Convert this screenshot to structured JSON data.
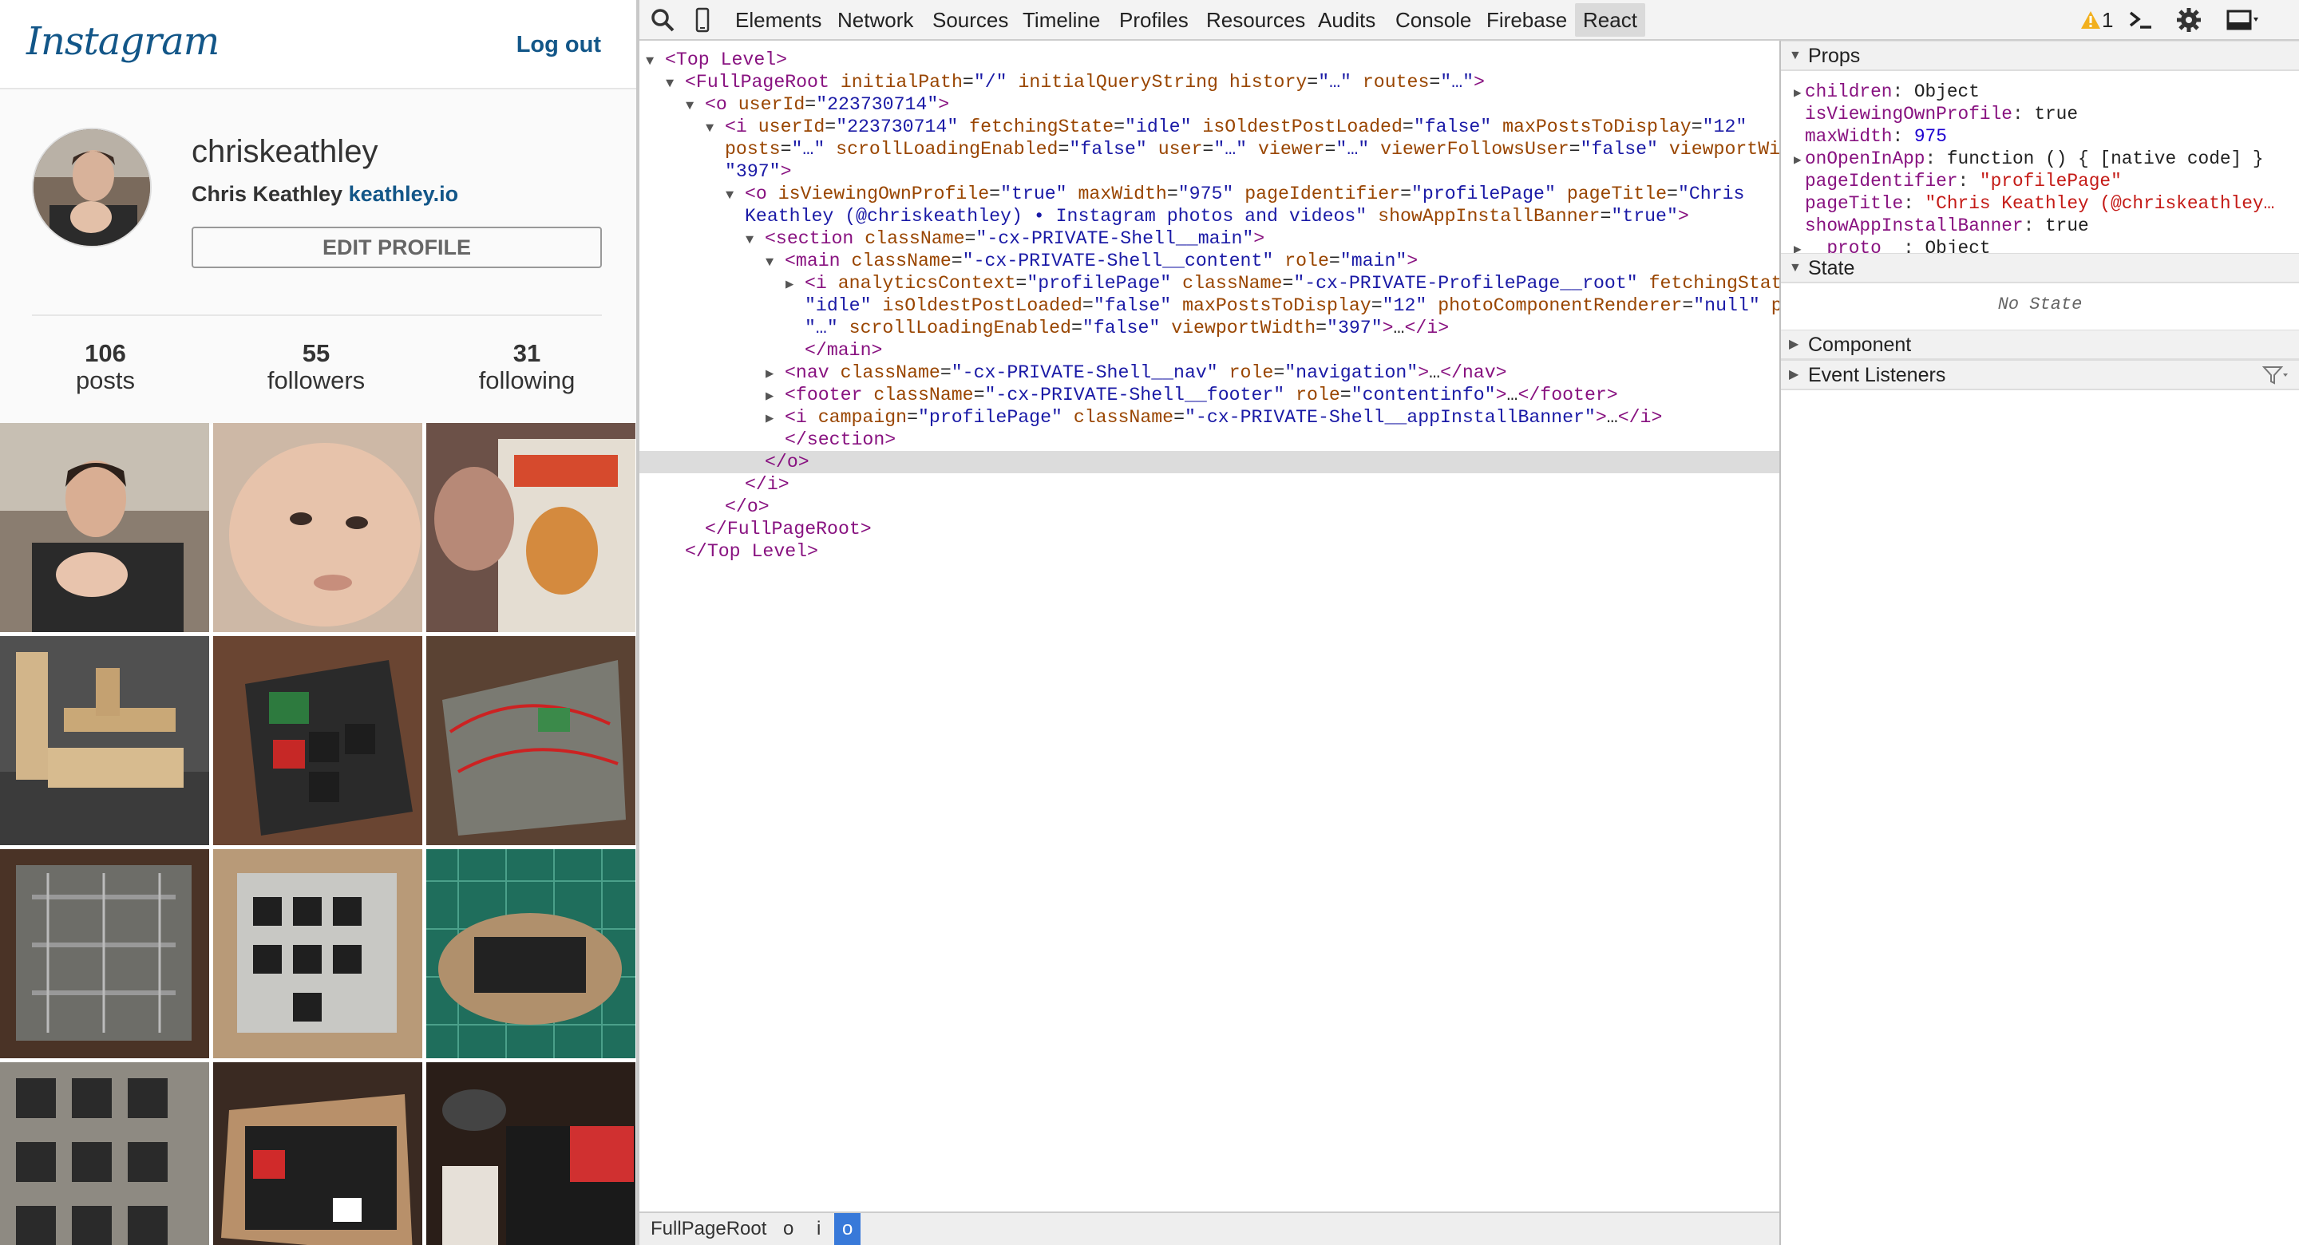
{
  "instagram": {
    "logo": "Instagram",
    "logout": "Log out",
    "username": "chriskeathley",
    "full_name": "Chris Keathley",
    "website": "keathley.io",
    "edit_profile": "EDIT PROFILE",
    "stats": [
      {
        "num": "106",
        "label": "posts"
      },
      {
        "num": "55",
        "label": "followers"
      },
      {
        "num": "31",
        "label": "following"
      }
    ],
    "photos": [
      "man-holding-baby",
      "baby-face",
      "child-with-toy-box",
      "wooden-blocks",
      "keyboard-wiring-red",
      "keyboard-switches-wired",
      "keyboard-hand-wired-closeup",
      "keyboard-switch-plate",
      "keyboard-on-cutting-mat",
      "keyboard-switches-rows",
      "keyboard-with-wooden-case",
      "keyboard-parts-red-keys"
    ]
  },
  "devtools": {
    "tabs": [
      "Elements",
      "Network",
      "Sources",
      "Timeline",
      "Profiles",
      "Resources",
      "Audits",
      "Console",
      "Firebase",
      "React"
    ],
    "active_tab": "React",
    "warning_count": "1",
    "tree": [
      {
        "indent": 0,
        "tri": "▼",
        "html": "<span class='tag'>&lt;Top Level&gt;</span>"
      },
      {
        "indent": 1,
        "tri": "▼",
        "html": "<span class='tag'>&lt;FullPageRoot</span> <span class='an'>initialPath</span>=<span class='av'>\"/\"</span> <span class='an'>initialQueryString</span> <span class='an'>history</span>=<span class='av'>\"…\"</span> <span class='an'>routes</span>=<span class='av'>\"…\"</span><span class='tag'>&gt;</span>"
      },
      {
        "indent": 2,
        "tri": "▼",
        "html": "<span class='tag'>&lt;o</span> <span class='an'>userId</span>=<span class='av'>\"223730714\"</span><span class='tag'>&gt;</span>"
      },
      {
        "indent": 3,
        "tri": "▼",
        "html": "<span class='tag'>&lt;i</span> <span class='an'>userId</span>=<span class='av'>\"223730714\"</span> <span class='an'>fetchingState</span>=<span class='av'>\"idle\"</span> <span class='an'>isOldestPostLoaded</span>=<span class='av'>\"false\"</span> <span class='an'>maxPostsToDisplay</span>=<span class='av'>\"12\"</span>"
      },
      {
        "indent": 3,
        "tri": "",
        "html": "<span class='an'>posts</span>=<span class='av'>\"…\"</span> <span class='an'>scrollLoadingEnabled</span>=<span class='av'>\"false\"</span> <span class='an'>user</span>=<span class='av'>\"…\"</span> <span class='an'>viewer</span>=<span class='av'>\"…\"</span> <span class='an'>viewerFollowsUser</span>=<span class='av'>\"false\"</span> <span class='an'>viewportWidth</span>="
      },
      {
        "indent": 3,
        "tri": "",
        "html": "<span class='av'>\"397\"</span><span class='tag'>&gt;</span>"
      },
      {
        "indent": 4,
        "tri": "▼",
        "html": "<span class='tag'>&lt;o</span> <span class='an'>isViewingOwnProfile</span>=<span class='av'>\"true\"</span> <span class='an'>maxWidth</span>=<span class='av'>\"975\"</span> <span class='an'>pageIdentifier</span>=<span class='av'>\"profilePage\"</span> <span class='an'>pageTitle</span>=<span class='av'>\"Chris</span>"
      },
      {
        "indent": 4,
        "tri": "",
        "html": "<span class='av'>Keathley (@chriskeathley) • Instagram photos and videos\"</span> <span class='an'>showAppInstallBanner</span>=<span class='av'>\"true\"</span><span class='tag'>&gt;</span>"
      },
      {
        "indent": 5,
        "tri": "▼",
        "html": "<span class='tag'>&lt;section</span> <span class='an'>className</span>=<span class='av'>\"-cx-PRIVATE-Shell__main\"</span><span class='tag'>&gt;</span>"
      },
      {
        "indent": 6,
        "tri": "▼",
        "html": "<span class='tag'>&lt;main</span> <span class='an'>className</span>=<span class='av'>\"-cx-PRIVATE-Shell__content\"</span> <span class='an'>role</span>=<span class='av'>\"main\"</span><span class='tag'>&gt;</span>"
      },
      {
        "indent": 7,
        "tri": "▶",
        "html": "<span class='tag'>&lt;i</span> <span class='an'>analyticsContext</span>=<span class='av'>\"profilePage\"</span> <span class='an'>className</span>=<span class='av'>\"-cx-PRIVATE-ProfilePage__root\"</span> <span class='an'>fetchingState</span>="
      },
      {
        "indent": 7,
        "tri": "",
        "html": "<span class='av'>\"idle\"</span> <span class='an'>isOldestPostLoaded</span>=<span class='av'>\"false\"</span> <span class='an'>maxPostsToDisplay</span>=<span class='av'>\"12\"</span> <span class='an'>photoComponentRenderer</span>=<span class='av'>\"null\"</span> <span class='an'>posts</span>="
      },
      {
        "indent": 7,
        "tri": "",
        "html": "<span class='av'>\"…\"</span> <span class='an'>scrollLoadingEnabled</span>=<span class='av'>\"false\"</span> <span class='an'>viewportWidth</span>=<span class='av'>\"397\"</span><span class='tag'>&gt;</span>…<span class='tag'>&lt;/i&gt;</span>"
      },
      {
        "indent": 7,
        "tri": "",
        "html": "<span class='tag'>&lt;/main&gt;</span>"
      },
      {
        "indent": 6,
        "tri": "▶",
        "html": "<span class='tag'>&lt;nav</span> <span class='an'>className</span>=<span class='av'>\"-cx-PRIVATE-Shell__nav\"</span> <span class='an'>role</span>=<span class='av'>\"navigation\"</span><span class='tag'>&gt;</span>…<span class='tag'>&lt;/nav&gt;</span>"
      },
      {
        "indent": 6,
        "tri": "▶",
        "html": "<span class='tag'>&lt;footer</span> <span class='an'>className</span>=<span class='av'>\"-cx-PRIVATE-Shell__footer\"</span> <span class='an'>role</span>=<span class='av'>\"contentinfo\"</span><span class='tag'>&gt;</span>…<span class='tag'>&lt;/footer&gt;</span>"
      },
      {
        "indent": 6,
        "tri": "▶",
        "html": "<span class='tag'>&lt;i</span> <span class='an'>campaign</span>=<span class='av'>\"profilePage\"</span> <span class='an'>className</span>=<span class='av'>\"-cx-PRIVATE-Shell__appInstallBanner\"</span><span class='tag'>&gt;</span>…<span class='tag'>&lt;/i&gt;</span>"
      },
      {
        "indent": 6,
        "tri": "",
        "html": "<span class='tag'>&lt;/section&gt;</span>"
      },
      {
        "indent": 5,
        "tri": "",
        "html": "<span class='tag'>&lt;/o&gt;</span>",
        "selected": true
      },
      {
        "indent": 4,
        "tri": "",
        "html": "<span class='tag'>&lt;/i&gt;</span>"
      },
      {
        "indent": 3,
        "tri": "",
        "html": "<span class='tag'>&lt;/o&gt;</span>"
      },
      {
        "indent": 2,
        "tri": "",
        "html": "<span class='tag'>&lt;/FullPageRoot&gt;</span>"
      },
      {
        "indent": 1,
        "tri": "",
        "html": "<span class='tag'>&lt;/Top Level&gt;</span>"
      }
    ],
    "breadcrumbs": [
      "FullPageRoot",
      "o",
      "i",
      "o"
    ],
    "sidebar": {
      "props_title": "Props",
      "props": [
        {
          "tri": "▶",
          "key": "children",
          "val": "Object",
          "type": "plain"
        },
        {
          "tri": "",
          "key": "isViewingOwnProfile",
          "val": "true",
          "type": "plain"
        },
        {
          "tri": "",
          "key": "maxWidth",
          "val": "975",
          "type": "num"
        },
        {
          "tri": "▶",
          "key": "onOpenInApp",
          "val": "function () { [native code] }",
          "type": "plain"
        },
        {
          "tri": "",
          "key": "pageIdentifier",
          "val": "\"profilePage\"",
          "type": "str"
        },
        {
          "tri": "",
          "key": "pageTitle",
          "val": "\"Chris Keathley (@chriskeathley…",
          "type": "str"
        },
        {
          "tri": "",
          "key": "showAppInstallBanner",
          "val": "true",
          "type": "plain"
        },
        {
          "tri": "▶",
          "key": "__proto__",
          "val": "Object",
          "type": "plain"
        }
      ],
      "state_title": "State",
      "no_state": "No State",
      "component_title": "Component",
      "event_listeners_title": "Event Listeners"
    }
  }
}
